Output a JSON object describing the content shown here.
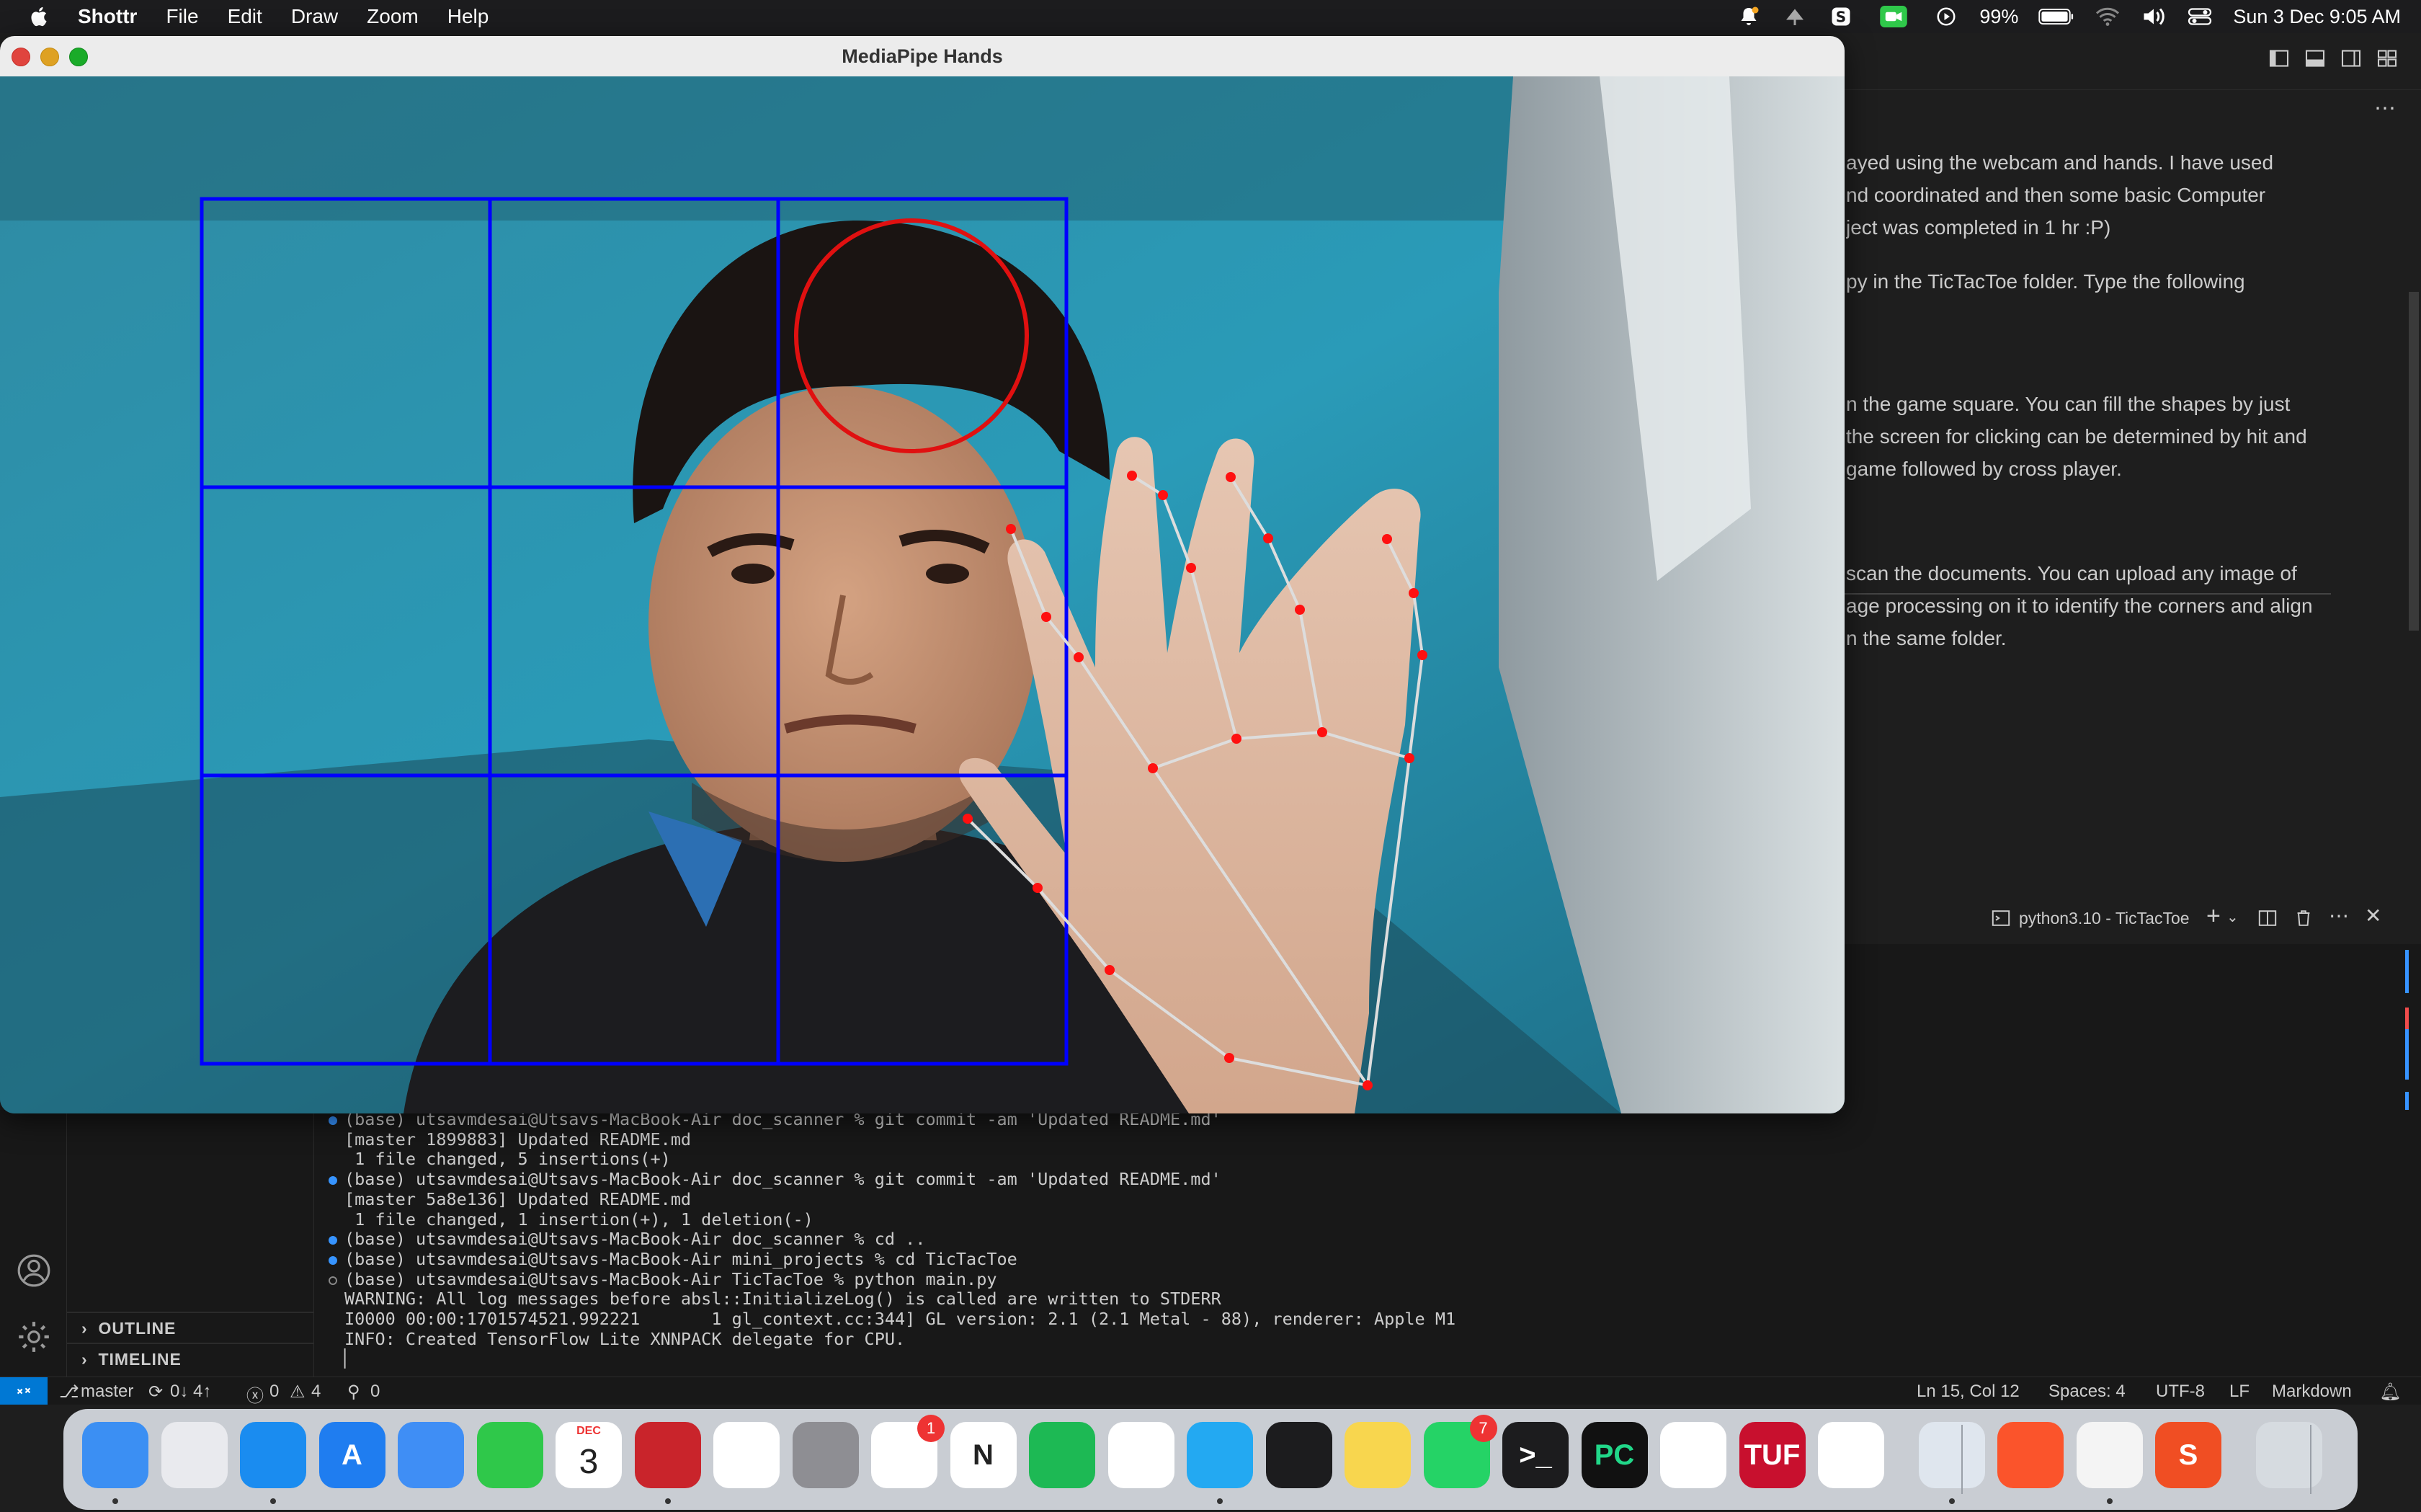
{
  "menubar": {
    "app": "Shottr",
    "items": [
      "File",
      "Edit",
      "Draw",
      "Zoom",
      "Help"
    ],
    "battery": "99%",
    "datetime": "Sun 3 Dec  9:05 AM"
  },
  "mediapipe_window": {
    "title": "MediaPipe Hands",
    "grid": {
      "rows": 3,
      "cols": 3,
      "color": "#0000ff"
    },
    "marks": [
      {
        "type": "circle",
        "row": 0,
        "col": 2,
        "color": "#e01010"
      }
    ],
    "landmark_color": "#ff1010",
    "connection_color": "#dddddd"
  },
  "editor": {
    "readme_lines": [
      "ayed using the webcam and hands. I have used",
      "nd coordinated and then some basic Computer",
      "ject was completed in 1 hr :P)",
      "py in the TicTacToe folder. Type the following",
      "",
      "",
      "",
      "n the game square. You can fill the shapes by just",
      " the screen for clicking can be determined by hit and",
      "game followed by cross player.",
      "",
      "",
      "",
      " scan the documents. You can upload any image of",
      "age processing on it to identify the corners and align",
      "n the same folder."
    ]
  },
  "panel": {
    "terminal_tab": "python3.10 - TicTacToe"
  },
  "terminal": {
    "lines": [
      {
        "dot": "blue",
        "text": "(base) utsavmdesai@Utsavs-MacBook-Air doc_scanner % git commit -am 'Updated README.md'"
      },
      {
        "dot": "",
        "text": "[master 1899883] Updated README.md"
      },
      {
        "dot": "",
        "text": " 1 file changed, 5 insertions(+)"
      },
      {
        "dot": "blue",
        "text": "(base) utsavmdesai@Utsavs-MacBook-Air doc_scanner % git commit -am 'Updated README.md'"
      },
      {
        "dot": "",
        "text": "[master 5a8e136] Updated README.md"
      },
      {
        "dot": "",
        "text": " 1 file changed, 1 insertion(+), 1 deletion(-)"
      },
      {
        "dot": "blue",
        "text": "(base) utsavmdesai@Utsavs-MacBook-Air doc_scanner % cd .."
      },
      {
        "dot": "blue",
        "text": "(base) utsavmdesai@Utsavs-MacBook-Air mini_projects % cd TicTacToe"
      },
      {
        "dot": "hollow",
        "text": "(base) utsavmdesai@Utsavs-MacBook-Air TicTacToe % python main.py"
      },
      {
        "dot": "",
        "text": "WARNING: All log messages before absl::InitializeLog() is called are written to STDERR"
      },
      {
        "dot": "",
        "text": "I0000 00:00:1701574521.992221       1 gl_context.cc:344] GL version: 2.1 (2.1 Metal - 88), renderer: Apple M1"
      },
      {
        "dot": "",
        "text": "INFO: Created TensorFlow Lite XNNPACK delegate for CPU."
      },
      {
        "dot": "",
        "text": "▏"
      }
    ]
  },
  "sidebar": {
    "sections": [
      "OUTLINE",
      "TIMELINE"
    ]
  },
  "statusbar": {
    "branch": "master",
    "sync": "0↓ 4↑",
    "errors": "0",
    "warnings": "4",
    "ports": "0",
    "position": "Ln 15, Col 12",
    "spaces": "Spaces: 4",
    "encoding": "UTF-8",
    "eol": "LF",
    "language": "Markdown"
  },
  "dock": {
    "apps": [
      {
        "name": "finder-icon",
        "label": "",
        "color": "#3b8ff3"
      },
      {
        "name": "launchpad-icon",
        "label": "",
        "color": "#e9eaee"
      },
      {
        "name": "safari-icon",
        "label": "",
        "color": "#1a8cf0"
      },
      {
        "name": "app-store-icon",
        "label": "A",
        "color": "#1f7df0"
      },
      {
        "name": "mail-icon",
        "label": "",
        "color": "#3f8ef5"
      },
      {
        "name": "messages-icon",
        "label": "",
        "color": "#2fc84a"
      },
      {
        "name": "calendar-icon",
        "label": "3",
        "month": "DEC",
        "color": "#ffffff"
      },
      {
        "name": "photo-booth-icon",
        "label": "",
        "color": "#c9242b"
      },
      {
        "name": "google-photos-icon",
        "label": "",
        "color": "#ffffff"
      },
      {
        "name": "system-settings-icon",
        "label": "",
        "color": "#8e8e93"
      },
      {
        "name": "reminders-icon",
        "label": "",
        "color": "#ffffff",
        "badge": "1"
      },
      {
        "name": "notion-icon",
        "label": "N",
        "color": "#ffffff"
      },
      {
        "name": "spotify-icon",
        "label": "",
        "color": "#1db954"
      },
      {
        "name": "chrome-icon",
        "label": "",
        "color": "#ffffff"
      },
      {
        "name": "vscode-icon",
        "label": "",
        "color": "#23a9f2"
      },
      {
        "name": "activity-monitor-icon",
        "label": "",
        "color": "#1c1c1e"
      },
      {
        "name": "notes-icon",
        "label": "",
        "color": "#f8d64e"
      },
      {
        "name": "whatsapp-icon",
        "label": "",
        "color": "#25d366",
        "badge": "7"
      },
      {
        "name": "terminal-icon",
        "label": ">_",
        "color": "#1c1c1e"
      },
      {
        "name": "pycharm-icon",
        "label": "PC",
        "color": "#111111"
      },
      {
        "name": "photos-icon",
        "label": "",
        "color": "#ffffff"
      },
      {
        "name": "tuf-icon",
        "label": "TUF",
        "color": "#c8102e"
      },
      {
        "name": "google-meet-icon",
        "label": "",
        "color": "#ffffff"
      },
      {
        "name": "preview-icon",
        "label": "",
        "color": "#dfe6ee"
      },
      {
        "name": "brave-icon",
        "label": "",
        "color": "#fb542b"
      },
      {
        "name": "document-icon",
        "label": "",
        "color": "#f4f4f4"
      },
      {
        "name": "shottr-icon",
        "label": "S",
        "color": "#f04e23"
      },
      {
        "name": "trash-icon",
        "label": "",
        "color": "#d6dbe0"
      }
    ]
  }
}
